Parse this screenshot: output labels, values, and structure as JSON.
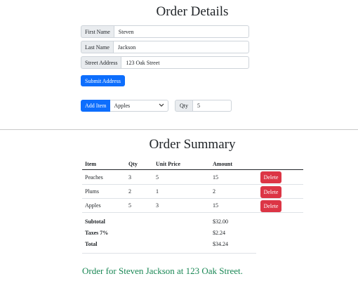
{
  "form": {
    "title": "Order Details",
    "first_name": {
      "label": "First Name",
      "value": "Steven"
    },
    "last_name": {
      "label": "Last Name",
      "value": "Jackson"
    },
    "street_address": {
      "label": "Street Address",
      "value": "123 Oak Street"
    },
    "submit_label": "Submit Address",
    "add_item_label": "Add Item",
    "item_select_value": "Apples",
    "qty_label": "Qty",
    "qty_value": "5"
  },
  "summary": {
    "title": "Order Summary",
    "headers": [
      "Item",
      "Qty",
      "Unit Price",
      "Amount"
    ],
    "rows": [
      {
        "item": "Peaches",
        "qty": "3",
        "unit_price": "5",
        "amount": "15",
        "delete_label": "Delete"
      },
      {
        "item": "Plums",
        "qty": "2",
        "unit_price": "1",
        "amount": "2",
        "delete_label": "Delete"
      },
      {
        "item": "Apples",
        "qty": "5",
        "unit_price": "3",
        "amount": "15",
        "delete_label": "Delete"
      }
    ],
    "totals": [
      {
        "label": "Subtotal",
        "value": "$32.00"
      },
      {
        "label": "Taxes 7%",
        "value": "$2.24"
      },
      {
        "label": "Total",
        "value": "$34.24"
      }
    ],
    "order_line": "Order for Steven Jackson at 123 Oak Street."
  },
  "colors": {
    "primary": "#0d6efd",
    "danger": "#dc3545",
    "success": "#198754"
  }
}
